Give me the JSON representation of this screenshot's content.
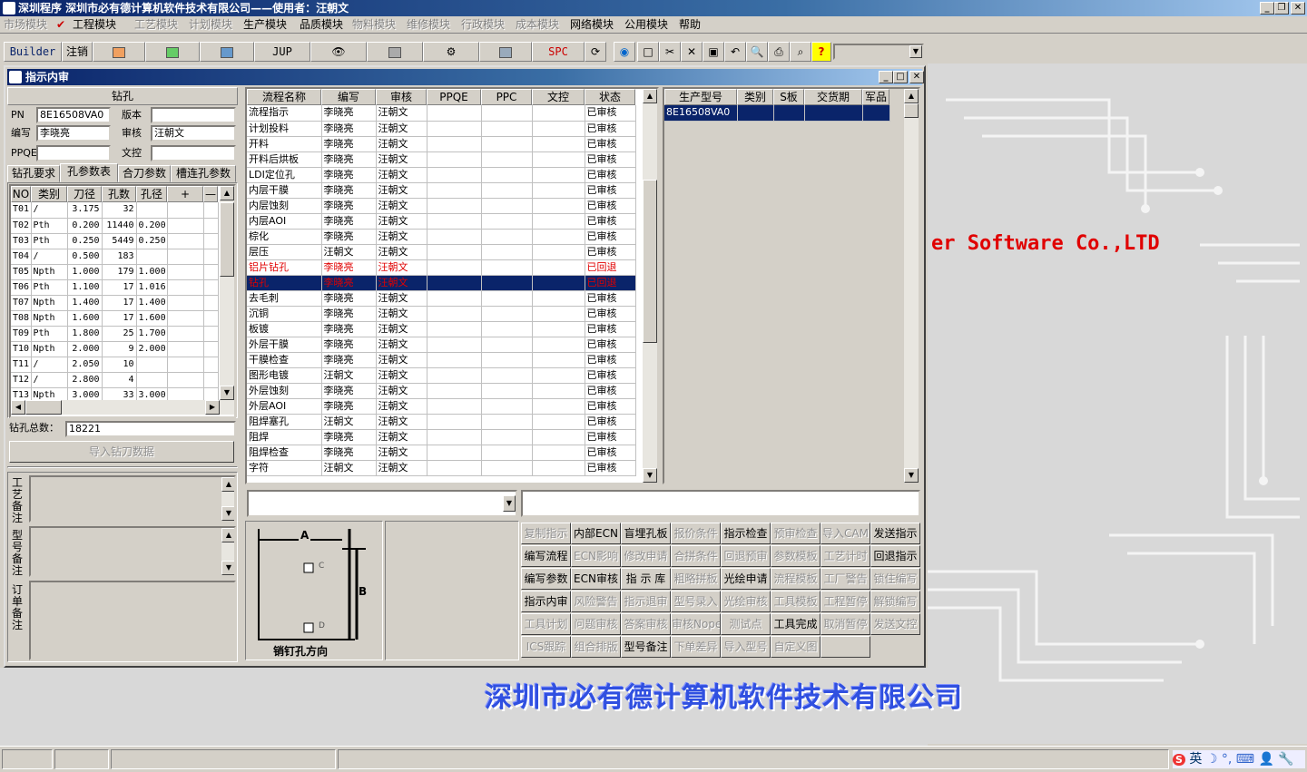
{
  "app": {
    "title": "深圳程序  深圳市必有德计算机软件技术有限公司——使用者：汪朝文"
  },
  "menu": [
    "市场模块",
    "工程模块",
    "工艺模块",
    "计划模块",
    "生产模块",
    "品质模块",
    "物料模块",
    "维修模块",
    "行政模块",
    "成本模块",
    "网络模块",
    "公用模块",
    "帮助"
  ],
  "menu_enabled": [
    false,
    true,
    false,
    false,
    true,
    true,
    false,
    false,
    false,
    false,
    true,
    true,
    true
  ],
  "toolbar": {
    "builder": "Builder",
    "logout": "注销",
    "jup": "JUP",
    "spc": "SPC"
  },
  "bg": {
    "english": "er Software Co.,LTD",
    "chinese": "深圳市必有德计算机软件技术有限公司"
  },
  "window": {
    "title": "指示内审"
  },
  "left": {
    "section_title": "钻孔",
    "pn_label": "PN",
    "pn_value": "8E16508VA0",
    "version_label": "版本",
    "version_value": "",
    "editor_label": "编写",
    "editor_value": "李晓亮",
    "reviewer_label": "审核",
    "reviewer_value": "汪朝文",
    "ppqe_label": "PPQE",
    "ppqe_value": "",
    "control_label": "文控",
    "control_value": "",
    "tabs": [
      "钻孔要求",
      "孔参数表",
      "合刀参数",
      "槽连孔参数"
    ],
    "drill_headers": [
      "NO",
      "类别",
      "刀径",
      "孔数",
      "孔径",
      "+",
      "—"
    ],
    "drill_rows": [
      [
        "T01",
        "/",
        "3.175",
        "32",
        ""
      ],
      [
        "T02",
        "Pth",
        "0.200",
        "11440",
        "0.200"
      ],
      [
        "T03",
        "Pth",
        "0.250",
        "5449",
        "0.250"
      ],
      [
        "T04",
        "/",
        "0.500",
        "183",
        ""
      ],
      [
        "T05",
        "Npth",
        "1.000",
        "179",
        "1.000"
      ],
      [
        "T06",
        "Pth",
        "1.100",
        "17",
        "1.016"
      ],
      [
        "T07",
        "Npth",
        "1.400",
        "17",
        "1.400"
      ],
      [
        "T08",
        "Npth",
        "1.600",
        "17",
        "1.600"
      ],
      [
        "T09",
        "Pth",
        "1.800",
        "25",
        "1.700"
      ],
      [
        "T10",
        "Npth",
        "2.000",
        "9",
        "2.000"
      ],
      [
        "T11",
        "/",
        "2.050",
        "10",
        ""
      ],
      [
        "T12",
        "/",
        "2.800",
        "4",
        ""
      ],
      [
        "T13",
        "Npth",
        "3.000",
        "33",
        "3.000"
      ]
    ],
    "total_label": "钻孔总数：",
    "total_value": "18221",
    "import_button": "导入钻刀数据",
    "notes": [
      "工艺备注",
      "型号备注",
      "订单备注"
    ]
  },
  "flow": {
    "headers": [
      "流程名称",
      "编写",
      "审核",
      "PPQE",
      "PPC",
      "文控",
      "状态"
    ],
    "rows": [
      [
        "流程指示",
        "李晓亮",
        "汪朝文",
        "",
        "",
        "",
        "已审核"
      ],
      [
        "计划投料",
        "李晓亮",
        "汪朝文",
        "",
        "",
        "",
        "已审核"
      ],
      [
        "开料",
        "李晓亮",
        "汪朝文",
        "",
        "",
        "",
        "已审核"
      ],
      [
        "开料后烘板",
        "李晓亮",
        "汪朝文",
        "",
        "",
        "",
        "已审核"
      ],
      [
        "LDI定位孔",
        "李晓亮",
        "汪朝文",
        "",
        "",
        "",
        "已审核"
      ],
      [
        "内层干膜",
        "李晓亮",
        "汪朝文",
        "",
        "",
        "",
        "已审核"
      ],
      [
        "内层蚀刻",
        "李晓亮",
        "汪朝文",
        "",
        "",
        "",
        "已审核"
      ],
      [
        "内层AOI",
        "李晓亮",
        "汪朝文",
        "",
        "",
        "",
        "已审核"
      ],
      [
        "棕化",
        "李晓亮",
        "汪朝文",
        "",
        "",
        "",
        "已审核"
      ],
      [
        "层压",
        "汪朝文",
        "汪朝文",
        "",
        "",
        "",
        "已审核"
      ],
      [
        "铝片钻孔",
        "李晓亮",
        "汪朝文",
        "",
        "",
        "",
        "已回退"
      ],
      [
        "钻孔",
        "李晓亮",
        "汪朝文",
        "",
        "",
        "",
        "已回退"
      ],
      [
        "去毛刺",
        "李晓亮",
        "汪朝文",
        "",
        "",
        "",
        "已审核"
      ],
      [
        "沉铜",
        "李晓亮",
        "汪朝文",
        "",
        "",
        "",
        "已审核"
      ],
      [
        "板镀",
        "李晓亮",
        "汪朝文",
        "",
        "",
        "",
        "已审核"
      ],
      [
        "外层干膜",
        "李晓亮",
        "汪朝文",
        "",
        "",
        "",
        "已审核"
      ],
      [
        "干膜检查",
        "李晓亮",
        "汪朝文",
        "",
        "",
        "",
        "已审核"
      ],
      [
        "图形电镀",
        "汪朝文",
        "汪朝文",
        "",
        "",
        "",
        "已审核"
      ],
      [
        "外层蚀刻",
        "李晓亮",
        "汪朝文",
        "",
        "",
        "",
        "已审核"
      ],
      [
        "外层AOI",
        "李晓亮",
        "汪朝文",
        "",
        "",
        "",
        "已审核"
      ],
      [
        "阻焊塞孔",
        "汪朝文",
        "汪朝文",
        "",
        "",
        "",
        "已审核"
      ],
      [
        "阻焊",
        "李晓亮",
        "汪朝文",
        "",
        "",
        "",
        "已审核"
      ],
      [
        "阻焊检查",
        "李晓亮",
        "汪朝文",
        "",
        "",
        "",
        "已审核"
      ],
      [
        "字符",
        "汪朝文",
        "汪朝文",
        "",
        "",
        "",
        "已审核"
      ]
    ]
  },
  "right": {
    "headers": [
      "生产型号",
      "类别",
      "S板",
      "交货期",
      "军品"
    ],
    "rows": [
      [
        "8E16508VA0",
        "",
        "",
        "",
        ""
      ]
    ]
  },
  "diagram": {
    "a": "A",
    "b": "B",
    "c": "C",
    "d": "D",
    "caption": "销钉孔方向"
  },
  "buttons": [
    [
      "复制指示",
      "内部ECN",
      "盲埋孔板",
      "报价条件",
      "指示检查",
      "预审检查",
      "导入CAM",
      "发送指示"
    ],
    [
      "编写流程",
      "ECN影响",
      "修改申请",
      "合拼条件",
      "回退预审",
      "参数模板",
      "工艺计时",
      "回退指示"
    ],
    [
      "编写参数",
      "ECN审核",
      "指 示 库",
      "粗略拼板",
      "光绘申请",
      "流程模板",
      "工厂警告",
      "锁住编写"
    ],
    [
      "指示内审",
      "风险警告",
      "指示退审",
      "型号录入",
      "光绘审核",
      "工具模板",
      "工程暂停",
      "解锁编写"
    ],
    [
      "工具计划",
      "问题审核",
      "答案审核",
      "审核Nope",
      "测试点",
      "工具完成",
      "取消暂停",
      "发送文控"
    ],
    [
      "ICS跟踪",
      "组合排版",
      "型号备注",
      "下单差异",
      "导入型号",
      "自定义图",
      ""
    ]
  ],
  "buttons_enabled": [
    [
      false,
      true,
      true,
      false,
      true,
      false,
      false,
      true
    ],
    [
      true,
      false,
      false,
      false,
      false,
      false,
      false,
      true
    ],
    [
      true,
      true,
      true,
      false,
      true,
      false,
      false,
      false
    ],
    [
      true,
      false,
      false,
      false,
      false,
      false,
      false,
      false
    ],
    [
      false,
      false,
      false,
      false,
      false,
      true,
      false,
      false
    ],
    [
      false,
      false,
      true,
      false,
      false,
      false,
      false
    ]
  ],
  "tray": {
    "lang": "英"
  }
}
